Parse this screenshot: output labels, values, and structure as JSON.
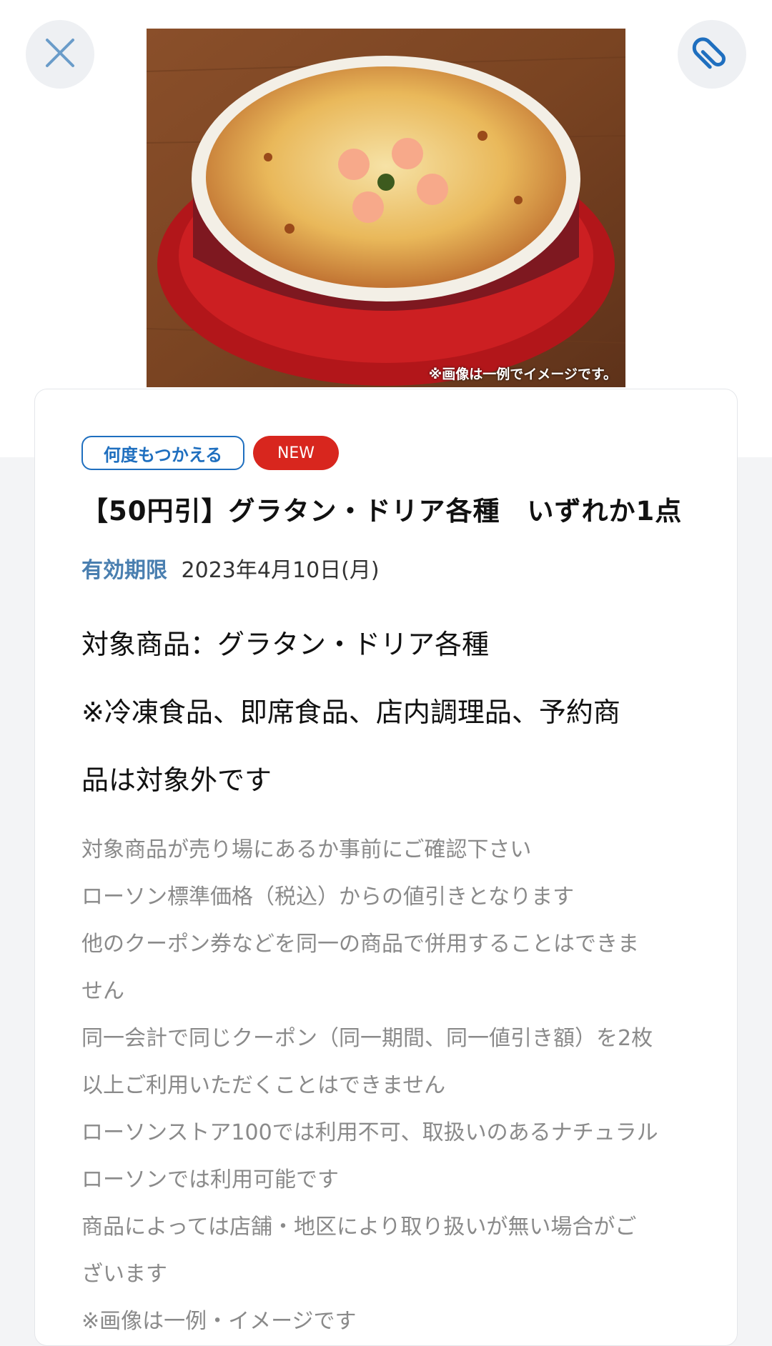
{
  "header": {
    "close_icon": "close-icon",
    "clip_icon": "paperclip-icon",
    "image_note": "※画像は一例でイメージです。"
  },
  "coupon": {
    "badges": {
      "reusable": "何度もつかえる",
      "new": "NEW"
    },
    "title": "【50円引】グラタン・ドリア各種　いずれか1点",
    "expiry_label": "有効期限",
    "expiry_value": "2023年4月10日(月)",
    "target_lines": [
      "対象商品：グラタン・ドリア各種",
      "※冷凍食品、即席食品、店内調理品、予約商",
      "品は対象外です"
    ],
    "notes": [
      "対象商品が売り場にあるか事前にご確認下さい",
      "ローソン標準価格（税込）からの値引きとなります",
      "他のクーポン券などを同一の商品で併用することはできま",
      "せん",
      "同一会計で同じクーポン（同一期間、同一値引き額）を2枚",
      "以上ご利用いただくことはできません",
      "ローソンストア100では利用不可、取扱いのあるナチュラル",
      "ローソンでは利用可能です",
      "商品によっては店舗・地区により取り扱いが無い場合がご",
      "ざいます",
      "※画像は一例・イメージです"
    ]
  },
  "colors": {
    "accent_blue": "#1f6fbf",
    "expiry_blue": "#4a7fb0",
    "new_red": "#d8261e",
    "note_gray": "#8a8a8a"
  }
}
